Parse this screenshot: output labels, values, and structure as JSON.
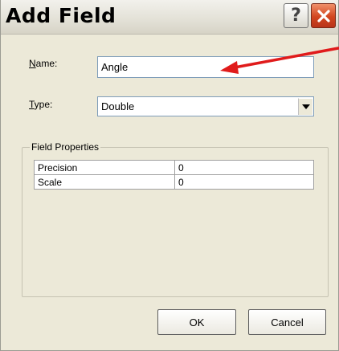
{
  "window": {
    "title": "Add Field",
    "help_glyph": "?",
    "close_icon": "close-x-icon"
  },
  "name_field": {
    "label_mnemonic": "N",
    "label_rest": "ame:",
    "value": "Angle"
  },
  "type_field": {
    "label_mnemonic": "T",
    "label_rest": "ype:",
    "value": "Double",
    "dropdown_icon": "chevron-down-icon"
  },
  "field_properties": {
    "legend": "Field Properties",
    "rows": [
      {
        "name": "Precision",
        "value": "0"
      },
      {
        "name": "Scale",
        "value": "0"
      }
    ]
  },
  "buttons": {
    "ok": "OK",
    "cancel": "Cancel"
  },
  "annotation": {
    "color": "#e01b1b"
  }
}
